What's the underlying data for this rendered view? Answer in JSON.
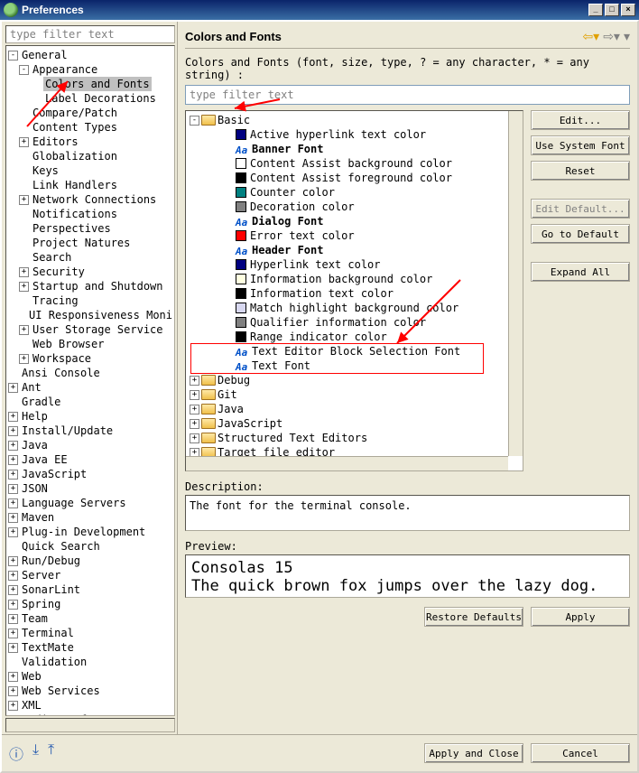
{
  "window": {
    "title": "Preferences"
  },
  "leftFilter": {
    "placeholder": "type filter text"
  },
  "leftTree": [
    {
      "lvl": 0,
      "exp": "-",
      "label": "General"
    },
    {
      "lvl": 1,
      "exp": "-",
      "label": "Appearance"
    },
    {
      "lvl": 2,
      "exp": "",
      "label": "Colors and Fonts",
      "sel": true
    },
    {
      "lvl": 2,
      "exp": "",
      "label": "Label Decorations"
    },
    {
      "lvl": 1,
      "exp": "",
      "label": "Compare/Patch"
    },
    {
      "lvl": 1,
      "exp": "",
      "label": "Content Types"
    },
    {
      "lvl": 1,
      "exp": "+",
      "label": "Editors"
    },
    {
      "lvl": 1,
      "exp": "",
      "label": "Globalization"
    },
    {
      "lvl": 1,
      "exp": "",
      "label": "Keys"
    },
    {
      "lvl": 1,
      "exp": "",
      "label": "Link Handlers"
    },
    {
      "lvl": 1,
      "exp": "+",
      "label": "Network Connections"
    },
    {
      "lvl": 1,
      "exp": "",
      "label": "Notifications"
    },
    {
      "lvl": 1,
      "exp": "",
      "label": "Perspectives"
    },
    {
      "lvl": 1,
      "exp": "",
      "label": "Project Natures"
    },
    {
      "lvl": 1,
      "exp": "",
      "label": "Search"
    },
    {
      "lvl": 1,
      "exp": "+",
      "label": "Security"
    },
    {
      "lvl": 1,
      "exp": "+",
      "label": "Startup and Shutdown"
    },
    {
      "lvl": 1,
      "exp": "",
      "label": "Tracing"
    },
    {
      "lvl": 1,
      "exp": "",
      "label": "UI Responsiveness Moni"
    },
    {
      "lvl": 1,
      "exp": "+",
      "label": "User Storage Service"
    },
    {
      "lvl": 1,
      "exp": "",
      "label": "Web Browser"
    },
    {
      "lvl": 1,
      "exp": "+",
      "label": "Workspace"
    },
    {
      "lvl": 0,
      "exp": "",
      "label": "Ansi Console"
    },
    {
      "lvl": 0,
      "exp": "+",
      "label": "Ant"
    },
    {
      "lvl": 0,
      "exp": "",
      "label": "Gradle"
    },
    {
      "lvl": 0,
      "exp": "+",
      "label": "Help"
    },
    {
      "lvl": 0,
      "exp": "+",
      "label": "Install/Update"
    },
    {
      "lvl": 0,
      "exp": "+",
      "label": "Java"
    },
    {
      "lvl": 0,
      "exp": "+",
      "label": "Java EE"
    },
    {
      "lvl": 0,
      "exp": "+",
      "label": "JavaScript"
    },
    {
      "lvl": 0,
      "exp": "+",
      "label": "JSON"
    },
    {
      "lvl": 0,
      "exp": "+",
      "label": "Language Servers"
    },
    {
      "lvl": 0,
      "exp": "+",
      "label": "Maven"
    },
    {
      "lvl": 0,
      "exp": "+",
      "label": "Plug-in Development"
    },
    {
      "lvl": 0,
      "exp": "",
      "label": "Quick Search"
    },
    {
      "lvl": 0,
      "exp": "+",
      "label": "Run/Debug"
    },
    {
      "lvl": 0,
      "exp": "+",
      "label": "Server"
    },
    {
      "lvl": 0,
      "exp": "+",
      "label": "SonarLint"
    },
    {
      "lvl": 0,
      "exp": "+",
      "label": "Spring"
    },
    {
      "lvl": 0,
      "exp": "+",
      "label": "Team"
    },
    {
      "lvl": 0,
      "exp": "+",
      "label": "Terminal"
    },
    {
      "lvl": 0,
      "exp": "+",
      "label": "TextMate"
    },
    {
      "lvl": 0,
      "exp": "",
      "label": "Validation"
    },
    {
      "lvl": 0,
      "exp": "+",
      "label": "Web"
    },
    {
      "lvl": 0,
      "exp": "+",
      "label": "Web Services"
    },
    {
      "lvl": 0,
      "exp": "+",
      "label": "XML"
    },
    {
      "lvl": 0,
      "exp": "+",
      "label": "YEdit Preferences"
    }
  ],
  "page": {
    "title": "Colors and Fonts",
    "hint": "Colors and Fonts (font, size, type, ? = any character, * = any string) :",
    "filterPlaceholder": "type filter text"
  },
  "colorTree": [
    {
      "lvl": 0,
      "exp": "-",
      "icon": "folder",
      "label": "Basic"
    },
    {
      "lvl": 2,
      "icon": "swatch",
      "color": "#000080",
      "label": "Active hyperlink text color"
    },
    {
      "lvl": 2,
      "icon": "aa",
      "label": "Banner Font",
      "bold": true
    },
    {
      "lvl": 2,
      "icon": "swatch",
      "color": "#ffffff",
      "label": "Content Assist background color"
    },
    {
      "lvl": 2,
      "icon": "swatch",
      "color": "#000000",
      "label": "Content Assist foreground color"
    },
    {
      "lvl": 2,
      "icon": "swatch",
      "color": "#008080",
      "label": "Counter color"
    },
    {
      "lvl": 2,
      "icon": "swatch",
      "color": "#808080",
      "label": "Decoration color"
    },
    {
      "lvl": 2,
      "icon": "aa",
      "label": "Dialog Font",
      "bold": true
    },
    {
      "lvl": 2,
      "icon": "swatch",
      "color": "#ff0000",
      "label": "Error text color"
    },
    {
      "lvl": 2,
      "icon": "aa",
      "label": "Header Font",
      "bold": true
    },
    {
      "lvl": 2,
      "icon": "swatch",
      "color": "#000080",
      "label": "Hyperlink text color"
    },
    {
      "lvl": 2,
      "icon": "swatch",
      "color": "#ffffe1",
      "label": "Information background color"
    },
    {
      "lvl": 2,
      "icon": "swatch",
      "color": "#000000",
      "label": "Information text color"
    },
    {
      "lvl": 2,
      "icon": "swatch",
      "color": "#d8d8f0",
      "label": "Match highlight background color"
    },
    {
      "lvl": 2,
      "icon": "swatch",
      "color": "#808080",
      "label": "Qualifier information color"
    },
    {
      "lvl": 2,
      "icon": "swatch",
      "color": "#000000",
      "label": "Range indicator color"
    },
    {
      "lvl": 2,
      "icon": "aa",
      "label": "Text Editor Block Selection Font"
    },
    {
      "lvl": 2,
      "icon": "aa",
      "label": "Text Font"
    },
    {
      "lvl": 0,
      "exp": "+",
      "icon": "folder",
      "label": "Debug"
    },
    {
      "lvl": 0,
      "exp": "+",
      "icon": "folder",
      "label": "Git"
    },
    {
      "lvl": 0,
      "exp": "+",
      "icon": "folder",
      "label": "Java"
    },
    {
      "lvl": 0,
      "exp": "+",
      "icon": "folder",
      "label": "JavaScript"
    },
    {
      "lvl": 0,
      "exp": "+",
      "icon": "folder",
      "label": "Structured Text Editors"
    },
    {
      "lvl": 0,
      "exp": "+",
      "icon": "folder",
      "label": "Target file editor"
    }
  ],
  "buttons": {
    "edit": "Edit...",
    "sysfont": "Use System Font",
    "reset": "Reset",
    "editdef": "Edit Default...",
    "godef": "Go to Default",
    "expand": "Expand All",
    "restore": "Restore Defaults",
    "apply": "Apply",
    "applyclose": "Apply and Close",
    "cancel": "Cancel"
  },
  "description": {
    "label": "Description:",
    "text": "The font for the terminal console."
  },
  "preview": {
    "label": "Preview:",
    "line1": "Consolas 15",
    "line2": "The quick brown fox jumps over the lazy dog."
  }
}
